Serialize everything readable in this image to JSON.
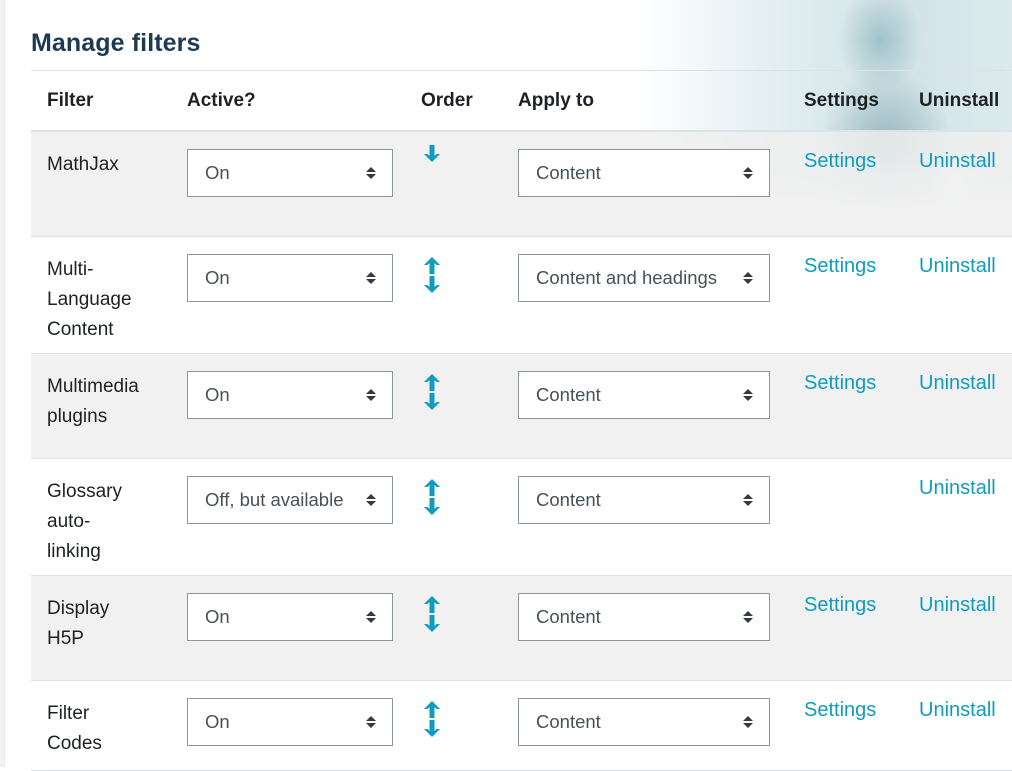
{
  "page": {
    "title": "Manage filters",
    "accent_color": "#0f9cbd"
  },
  "table": {
    "headers": {
      "filter": "Filter",
      "active": "Active?",
      "order": "Order",
      "apply_to": "Apply to",
      "settings": "Settings",
      "uninstall": "Uninstall"
    },
    "rows": [
      {
        "name_lines": [
          "MathJax"
        ],
        "active": "On",
        "order": [
          "down"
        ],
        "apply_to": "Content",
        "settings": "Settings",
        "uninstall": "Uninstall"
      },
      {
        "name_lines": [
          "Multi-",
          "Language",
          "Content"
        ],
        "active": "On",
        "order": [
          "up",
          "down"
        ],
        "apply_to": "Content and headings",
        "settings": "Settings",
        "uninstall": "Uninstall"
      },
      {
        "name_lines": [
          "Multimedia",
          "plugins"
        ],
        "active": "On",
        "order": [
          "up",
          "down"
        ],
        "apply_to": "Content",
        "settings": "Settings",
        "uninstall": "Uninstall"
      },
      {
        "name_lines": [
          "Glossary",
          "auto-",
          "linking"
        ],
        "active": "Off, but available",
        "order": [
          "up",
          "down"
        ],
        "apply_to": "Content",
        "settings": null,
        "uninstall": "Uninstall"
      },
      {
        "name_lines": [
          "Display",
          "H5P"
        ],
        "active": "On",
        "order": [
          "up",
          "down"
        ],
        "apply_to": "Content",
        "settings": "Settings",
        "uninstall": "Uninstall"
      },
      {
        "name_lines": [
          "Filter",
          "Codes"
        ],
        "active": "On",
        "order": [
          "up",
          "down"
        ],
        "apply_to": "Content",
        "settings": "Settings",
        "uninstall": "Uninstall"
      }
    ]
  },
  "icons": {
    "move_up": "arrow-up-icon",
    "move_down": "arrow-down-icon",
    "select_caret": "sort-caret-icon"
  }
}
